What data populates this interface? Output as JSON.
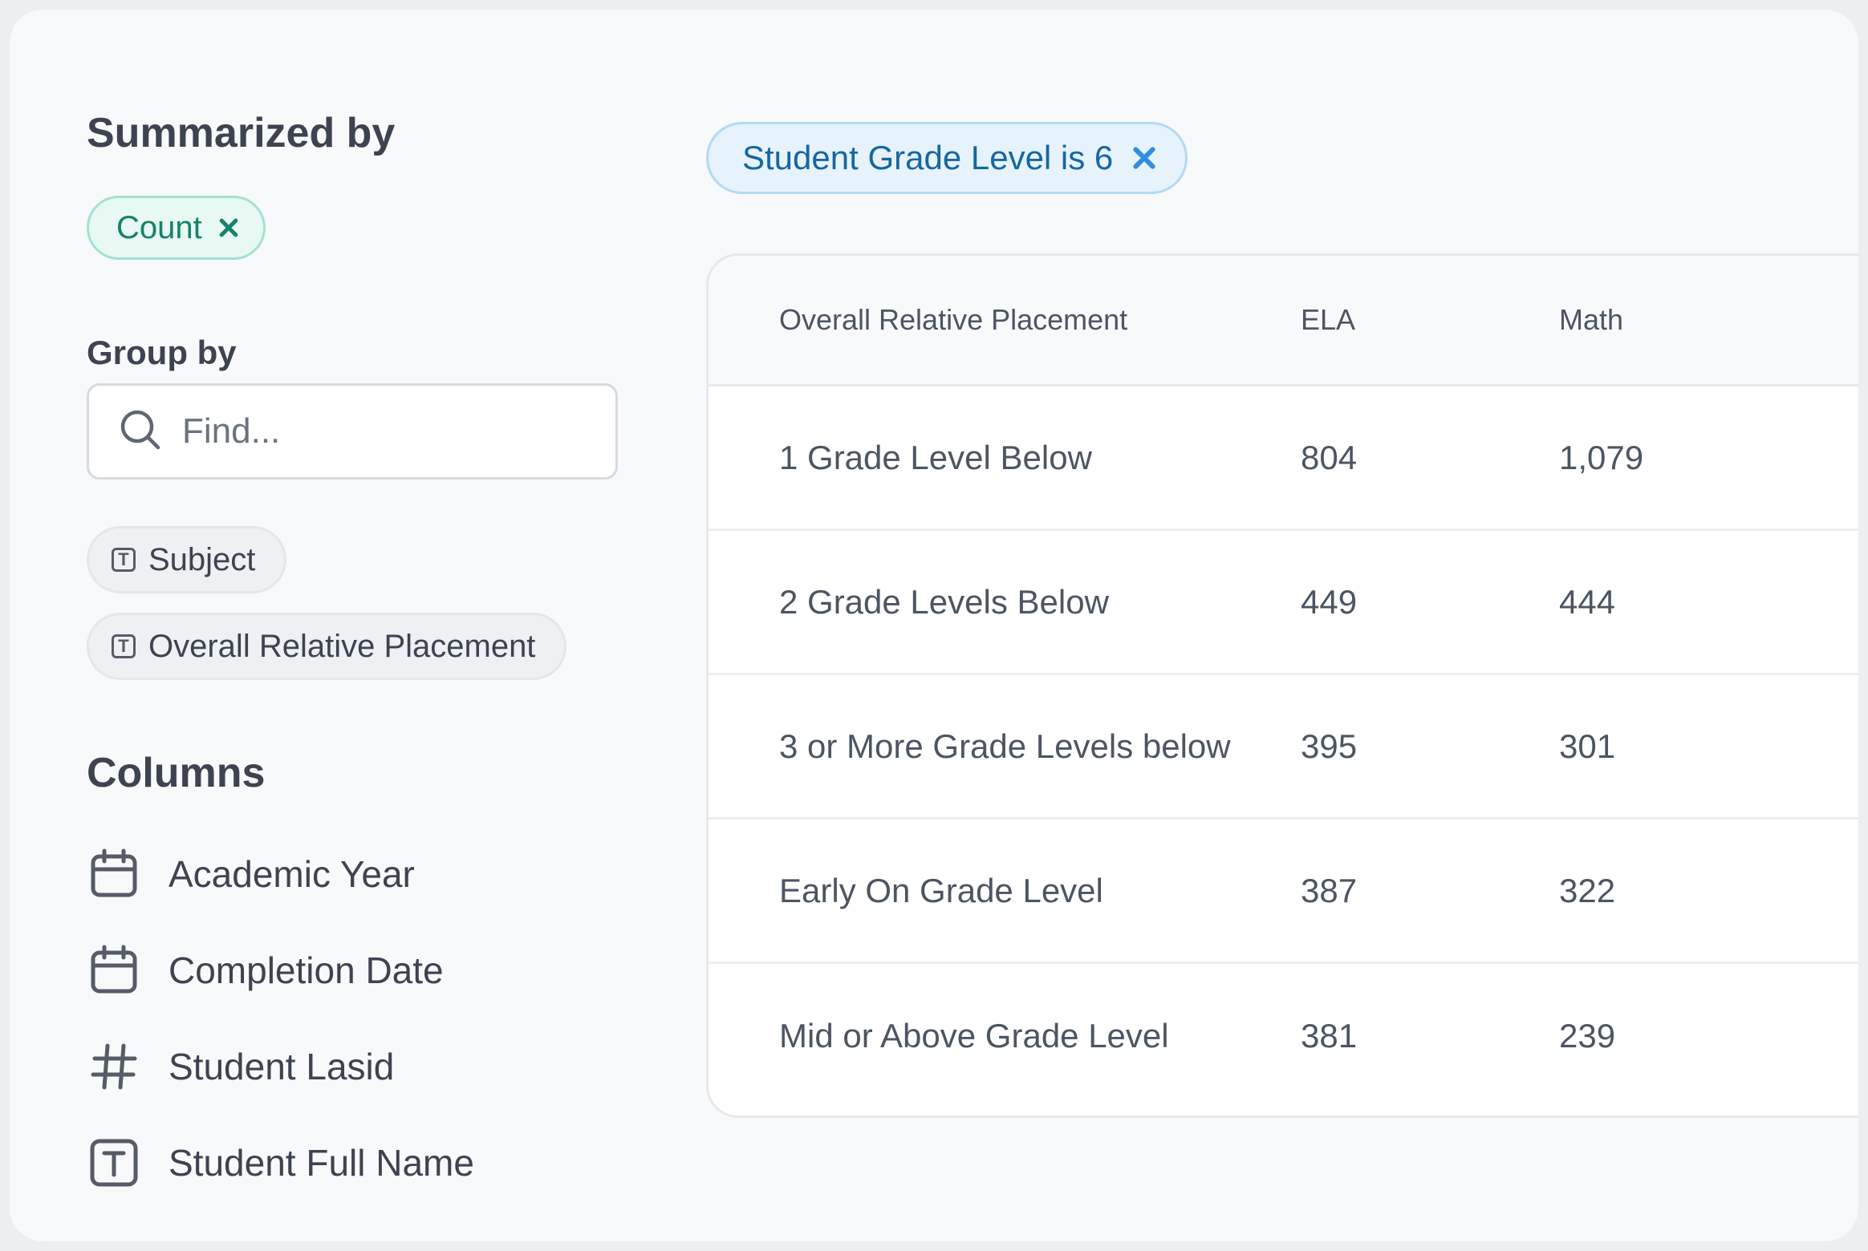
{
  "summarized": {
    "title": "Summarized by",
    "pill_label": "Count"
  },
  "group_by": {
    "title": "Group by",
    "search_placeholder": "Find...",
    "fields": [
      {
        "label": "Subject",
        "icon": "text-icon"
      },
      {
        "label": "Overall Relative Placement",
        "icon": "text-icon"
      }
    ]
  },
  "columns": {
    "title": "Columns",
    "items": [
      {
        "label": "Academic Year",
        "icon": "calendar-icon"
      },
      {
        "label": "Completion Date",
        "icon": "calendar-icon"
      },
      {
        "label": "Student Lasid",
        "icon": "hash-icon"
      },
      {
        "label": "Student Full Name",
        "icon": "text-icon"
      }
    ]
  },
  "filter": {
    "label": "Student Grade Level is 6"
  },
  "table": {
    "headers": [
      "Overall Relative Placement",
      "ELA",
      "Math"
    ],
    "rows": [
      [
        "1 Grade Level Below",
        "804",
        "1,079"
      ],
      [
        "2 Grade Levels Below",
        "449",
        "444"
      ],
      [
        "3 or More Grade Levels below",
        "395",
        "301"
      ],
      [
        "Early On Grade Level",
        "387",
        "322"
      ],
      [
        "Mid or Above Grade Level",
        "381",
        "239"
      ]
    ]
  },
  "colors": {
    "count_pill": "#e8f8f2",
    "filter_pill": "#e6f3fc",
    "background": "#f8f9fb"
  }
}
